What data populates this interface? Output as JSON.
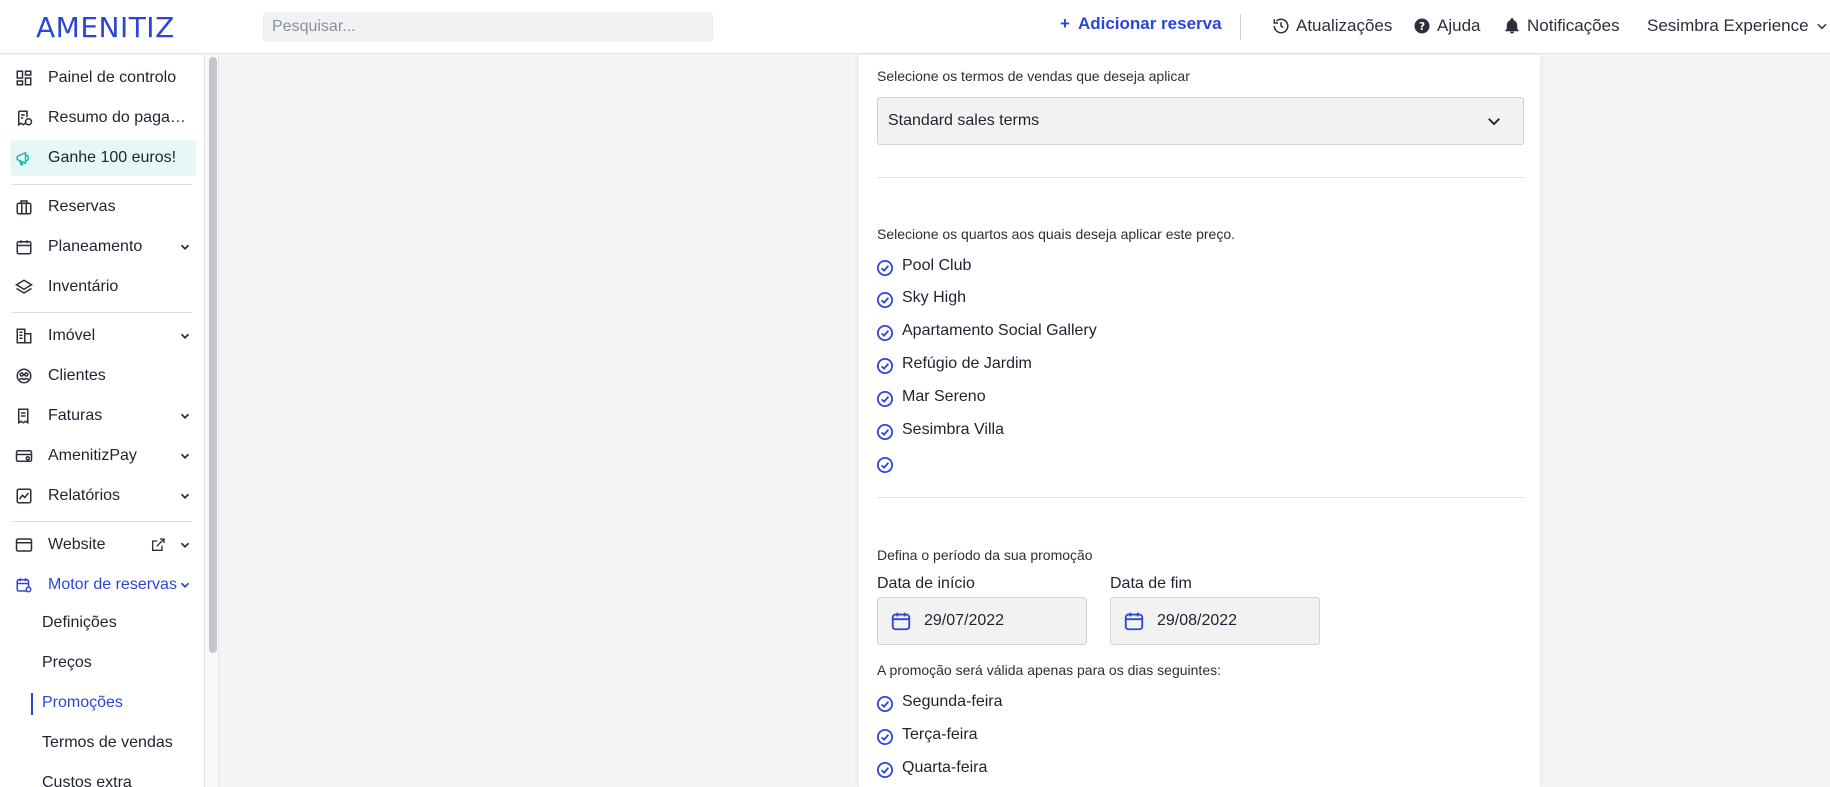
{
  "header": {
    "logo": "AMENITIZ",
    "search_placeholder": "Pesquisar...",
    "add_reservation": "Adicionar reserva",
    "updates": "Atualizações",
    "help": "Ajuda",
    "notifications": "Notificações",
    "account": "Sesimbra Experience"
  },
  "sidebar": {
    "items": [
      {
        "label": "Painel de controlo",
        "icon": "dashboard-icon"
      },
      {
        "label": "Resumo do pagamento",
        "icon": "payment-summary-icon"
      },
      {
        "label": "Ganhe 100 euros!",
        "icon": "megaphone-icon"
      },
      {
        "label": "Reservas",
        "icon": "briefcase-icon"
      },
      {
        "label": "Planeamento",
        "icon": "calendar-icon"
      },
      {
        "label": "Inventário",
        "icon": "layers-icon"
      },
      {
        "label": "Imóvel",
        "icon": "building-icon"
      },
      {
        "label": "Clientes",
        "icon": "clients-icon"
      },
      {
        "label": "Faturas",
        "icon": "invoice-icon"
      },
      {
        "label": "AmenitizPay",
        "icon": "card-icon"
      },
      {
        "label": "Relatórios",
        "icon": "chart-icon"
      },
      {
        "label": "Website",
        "icon": "browser-icon"
      },
      {
        "label": "Motor de reservas",
        "icon": "booking-engine-icon"
      }
    ],
    "subitems": [
      "Definições",
      "Preços",
      "Promoções",
      "Termos de vendas",
      "Custos extra"
    ]
  },
  "form": {
    "sales_terms_caption": "Selecione os termos de vendas que deseja aplicar",
    "sales_terms_value": "Standard sales terms",
    "rooms_caption": "Selecione os quartos aos quais deseja aplicar este preço.",
    "rooms": [
      "Pool Club",
      "Sky High",
      "Apartamento Social Gallery",
      "Refúgio de Jardim",
      "Mar Sereno",
      "Sesimbra Villa",
      ""
    ],
    "period_caption": "Defina o período da sua promoção",
    "start_label": "Data de início",
    "start_value": "29/07/2022",
    "end_label": "Data de fim",
    "end_value": "29/08/2022",
    "days_caption": "A promoção será válida apenas para os dias seguintes:",
    "days": [
      "Segunda-feira",
      "Terça-feira",
      "Quarta-feira"
    ]
  },
  "colors": {
    "accent": "#2b46d6",
    "highlight": "#e6f8f5",
    "teal_icon": "#1bb8a4"
  }
}
